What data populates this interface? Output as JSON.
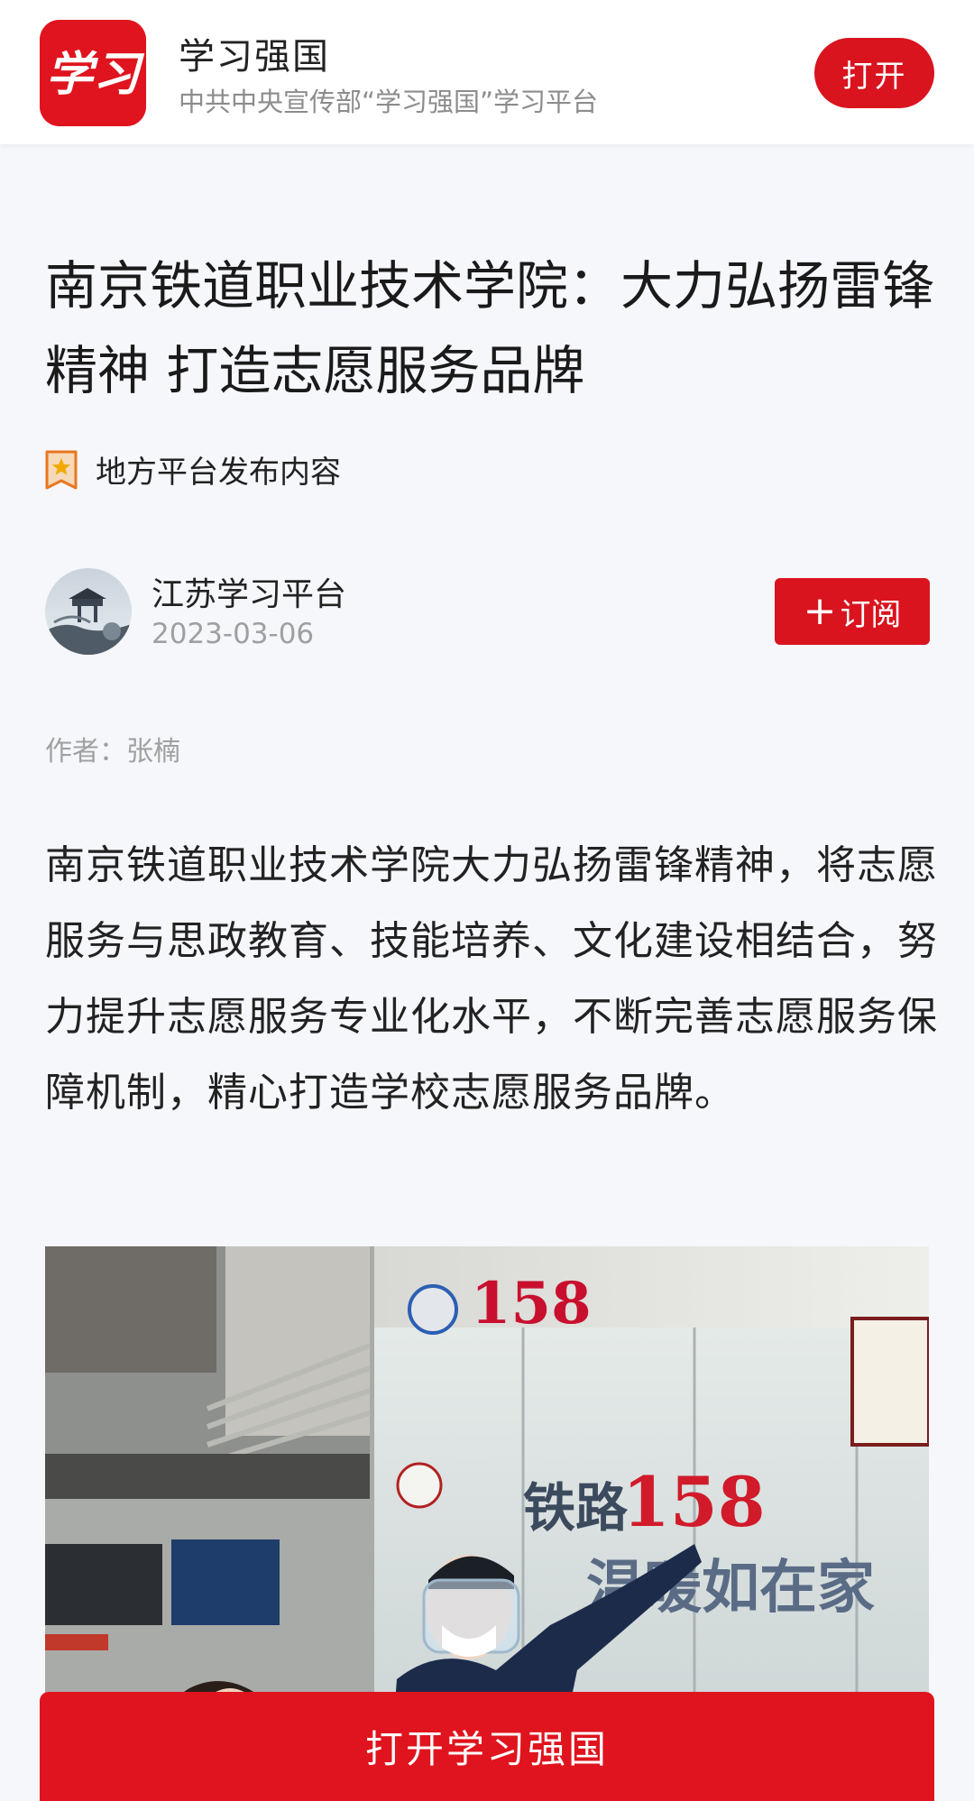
{
  "banner": {
    "logo_text": "学习",
    "app_name": "学习强国",
    "tagline": "中共中央宣传部“学习强国”学习平台",
    "open_label": "打开"
  },
  "article": {
    "title": "南京铁道职业技术学院：大力弘扬雷锋精神 打造志愿服务品牌",
    "source_tag": "地方平台发布内容",
    "publisher": "江苏学习平台",
    "date": "2023-03-06",
    "subscribe_label": "订阅",
    "author": "作者：张楠",
    "body": "南京铁道职业技术学院大力弘扬雷锋精神，将志愿服务与思政教育、技能培养、文化建设相结合，努力提升志愿服务专业化水平，不断完善志愿服务保障机制，精心打造学校志愿服务品牌。",
    "photo": {
      "sign_number": "158",
      "sign_text_1": "铁路",
      "sign_number_2": "158",
      "sign_text_2": "温暖如在家"
    }
  },
  "footer": {
    "open_app_label": "打开学习强国"
  },
  "colors": {
    "brand_red": "#d9141f",
    "background": "#f6f7fb",
    "muted_text": "#a0a0a0"
  },
  "icons": [
    "app-logo",
    "star-badge-icon",
    "plus-icon"
  ]
}
